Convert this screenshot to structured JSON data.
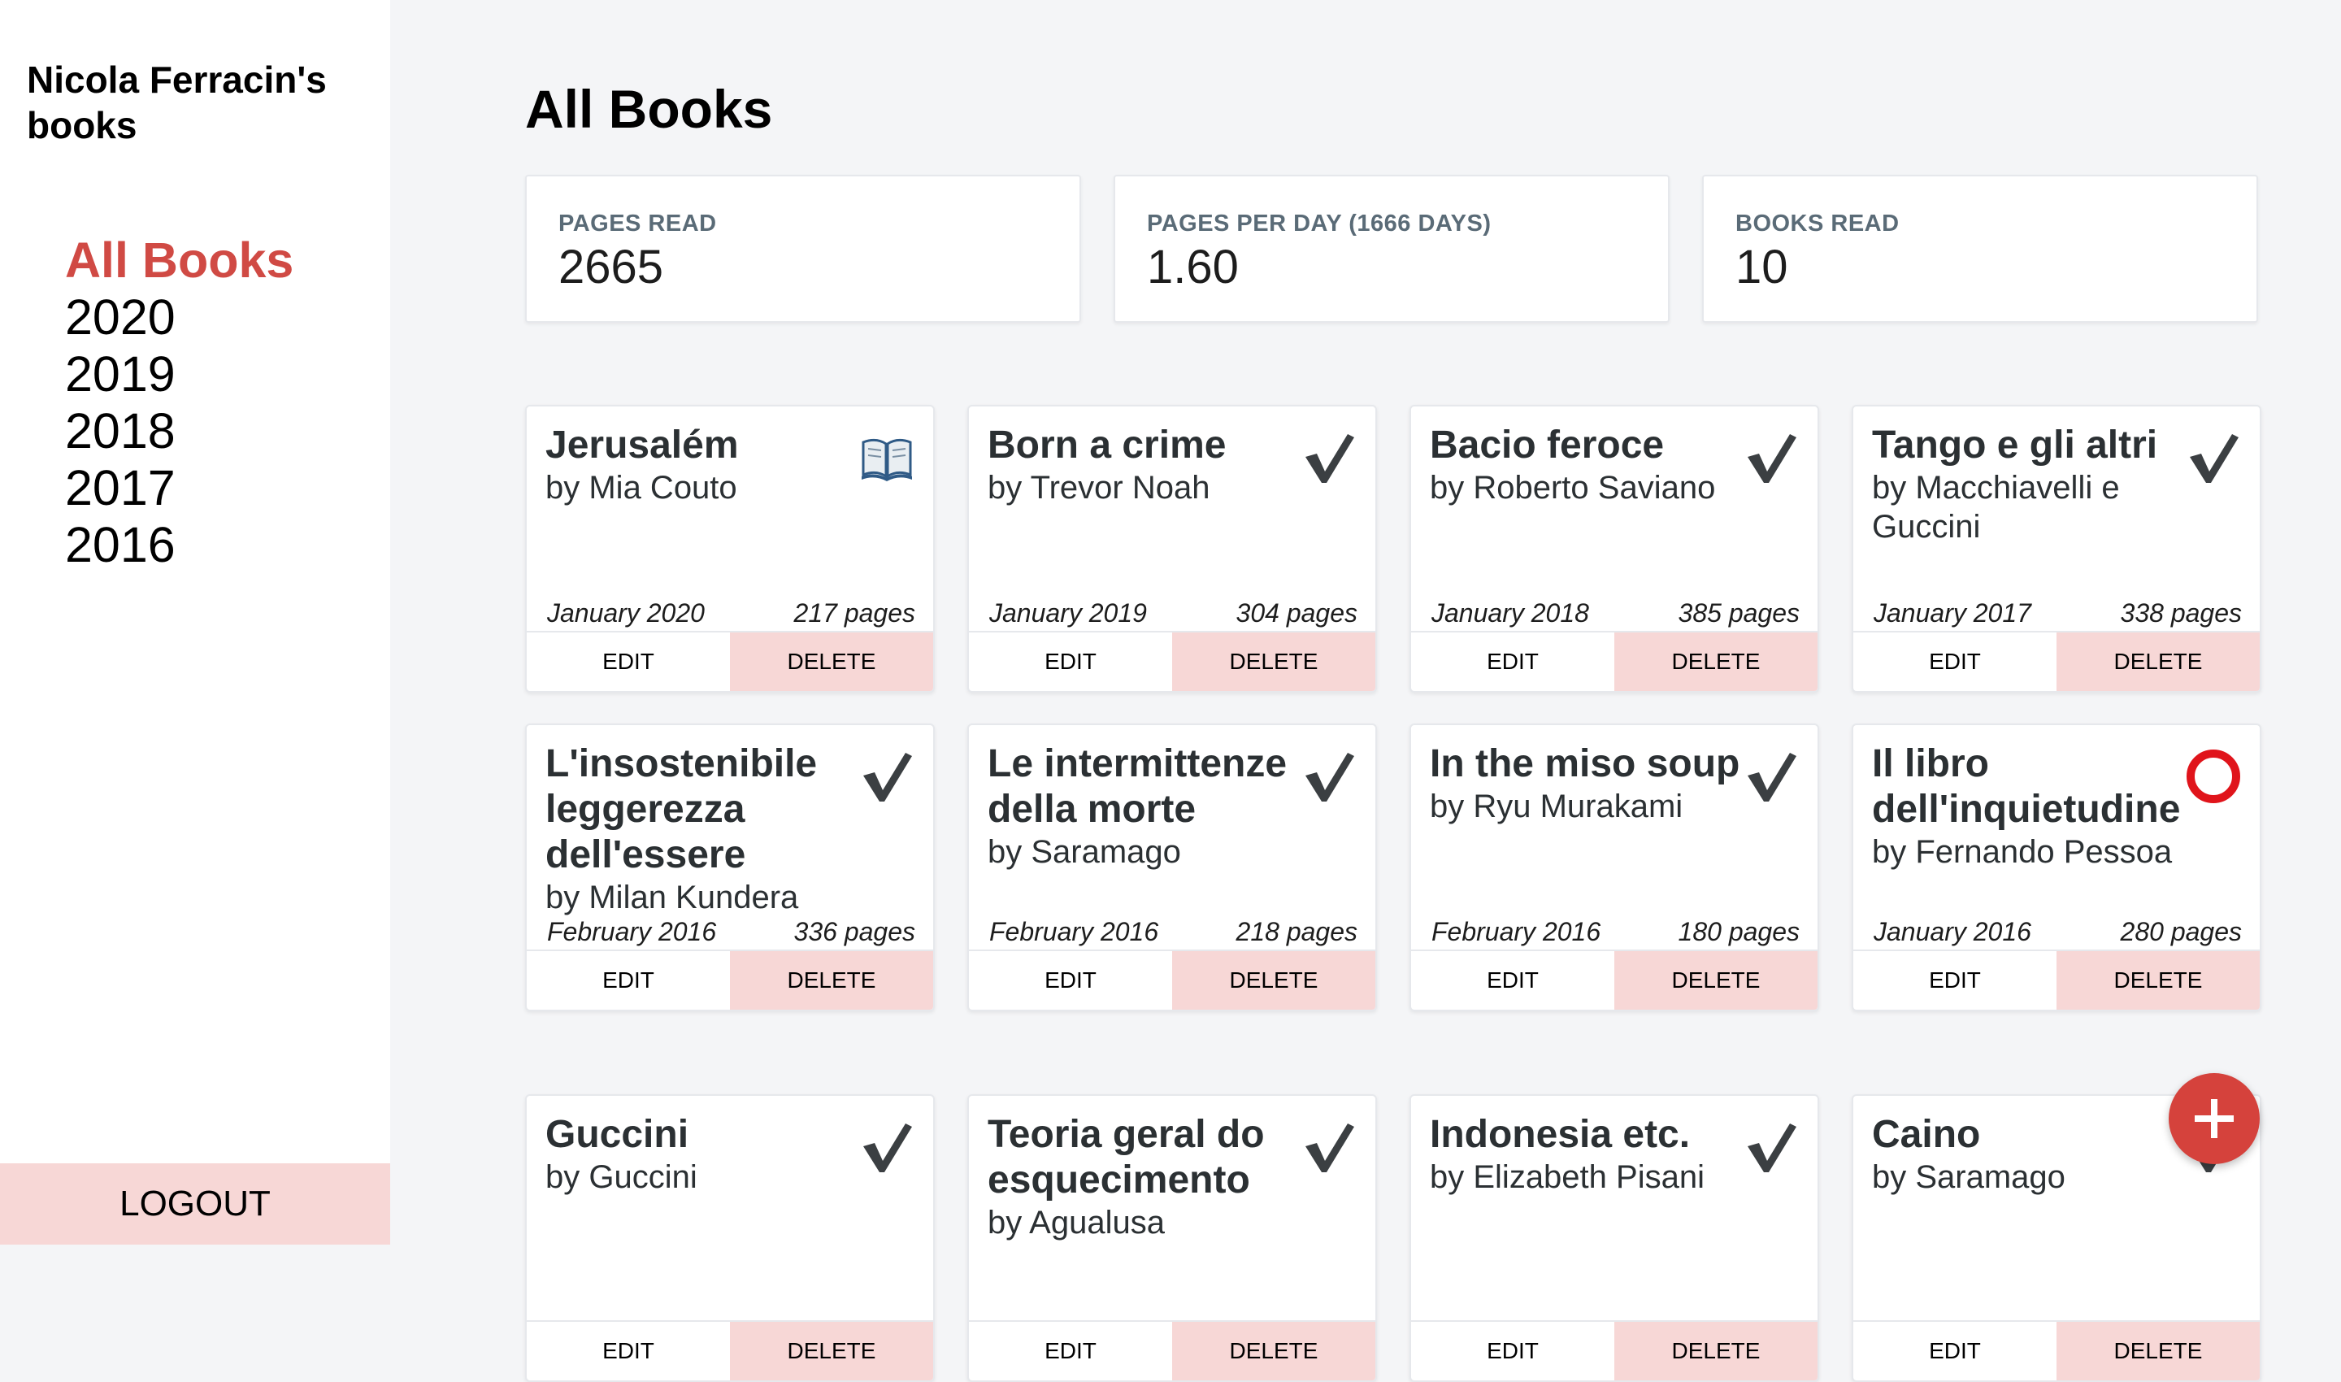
{
  "sidebar": {
    "brand": "Nicola Ferracin's books",
    "nav": [
      "All Books",
      "2020",
      "2019",
      "2018",
      "2017",
      "2016"
    ],
    "active_index": 0,
    "logout_label": "LOGOUT"
  },
  "main": {
    "title": "All Books",
    "stats": [
      {
        "label": "PAGES READ",
        "value": "2665"
      },
      {
        "label": "PAGES PER DAY (1666 DAYS)",
        "value": "1.60"
      },
      {
        "label": "BOOKS READ",
        "value": "10"
      }
    ],
    "card_actions": {
      "edit": "EDIT",
      "delete": "DELETE"
    },
    "books": [
      {
        "title": "Jerusalém",
        "author": "by Mia Couto",
        "date": "January 2020",
        "pages": "217 pages",
        "status_icon": "open-book-icon"
      },
      {
        "title": "Born a crime",
        "author": "by Trevor Noah",
        "date": "January 2019",
        "pages": "304 pages",
        "status_icon": "checkmark-icon"
      },
      {
        "title": "Bacio feroce",
        "author": "by Roberto Saviano",
        "date": "January 2018",
        "pages": "385 pages",
        "status_icon": "checkmark-icon"
      },
      {
        "title": "Tango e gli altri",
        "author": "by Macchiavelli e Guccini",
        "date": "January 2017",
        "pages": "338 pages",
        "status_icon": "checkmark-icon"
      },
      {
        "title": "L'insostenibile leggerezza dell'essere",
        "author": "by Milan Kundera",
        "date": "February 2016",
        "pages": "336 pages",
        "status_icon": "checkmark-icon"
      },
      {
        "title": "Le intermittenze della morte",
        "author": "by Saramago",
        "date": "February 2016",
        "pages": "218 pages",
        "status_icon": "checkmark-icon"
      },
      {
        "title": "In the miso soup",
        "author": "by Ryu Murakami",
        "date": "February 2016",
        "pages": "180 pages",
        "status_icon": "checkmark-icon"
      },
      {
        "title": "Il libro dell'inquietudine",
        "author": "by Fernando Pessoa",
        "date": "January 2016",
        "pages": "280 pages",
        "status_icon": "red-circle-icon"
      },
      {
        "title": "Guccini",
        "author": "by Guccini",
        "date": "",
        "pages": "",
        "status_icon": "checkmark-icon"
      },
      {
        "title": "Teoria geral do esquecimento",
        "author": "by Agualusa",
        "date": "",
        "pages": "",
        "status_icon": "checkmark-icon"
      },
      {
        "title": "Indonesia etc.",
        "author": "by Elizabeth Pisani",
        "date": "",
        "pages": "",
        "status_icon": "checkmark-icon"
      },
      {
        "title": "Caino",
        "author": "by Saramago",
        "date": "",
        "pages": "",
        "status_icon": "checkmark-icon"
      }
    ]
  },
  "colors": {
    "accent": "#d04a44",
    "delete_bg": "#f7d7d6",
    "fab": "#d5423c"
  },
  "fab_icon": "plus-icon"
}
